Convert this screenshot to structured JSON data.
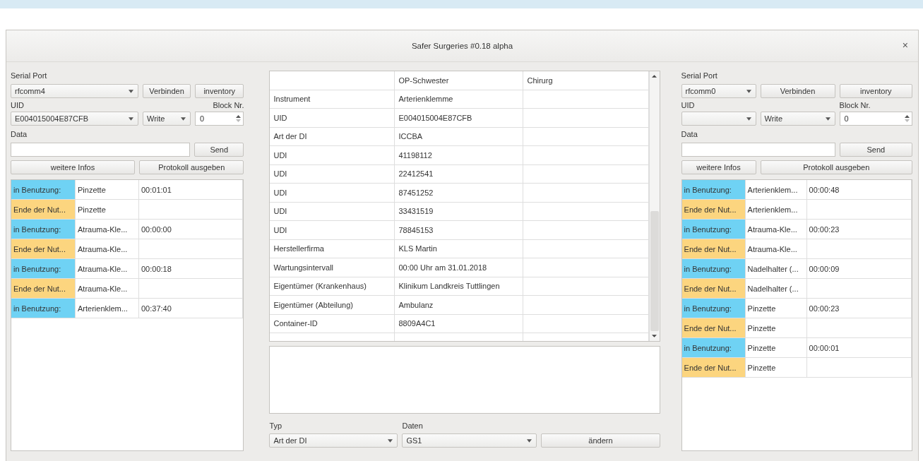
{
  "window": {
    "title": "Safer Surgeries #0.18 alpha",
    "close": "×"
  },
  "panels": [
    {
      "serial_port_label": "Serial Port",
      "port": "rfcomm4",
      "connect_button": "Verbinden",
      "inventory_button": "inventory",
      "uid_label": "UID",
      "block_label": "Block Nr.",
      "uid": "E004015004E87CFB",
      "mode": "Write",
      "block": "0",
      "data_label": "Data",
      "send_button": "Send",
      "info_button": "weitere Infos",
      "log_button": "Protokoll ausgeben",
      "log": [
        {
          "kind": "in_use",
          "status": "in Benutzung:",
          "instrument": "Pinzette",
          "time": "00:01:01"
        },
        {
          "kind": "end",
          "status": "Ende der Nut...",
          "instrument": "Pinzette"
        },
        {
          "kind": "in_use",
          "status": "in Benutzung:",
          "instrument": "Atrauma-Kle...",
          "time": "00:00:00"
        },
        {
          "kind": "end",
          "status": "Ende der Nut...",
          "instrument": "Atrauma-Kle..."
        },
        {
          "kind": "in_use",
          "status": "in Benutzung:",
          "instrument": "Atrauma-Kle...",
          "time": "00:00:18"
        },
        {
          "kind": "end",
          "status": "Ende der Nut...",
          "instrument": "Atrauma-Kle..."
        },
        {
          "kind": "in_use",
          "status": "in Benutzung:",
          "instrument": "Arterienklem...",
          "time": "00:37:40"
        }
      ]
    },
    {
      "serial_port_label": "Serial Port",
      "port": "rfcomm0",
      "connect_button": "Verbinden",
      "inventory_button": "inventory",
      "uid_label": "UID",
      "block_label": "Block Nr.",
      "mode": "Write",
      "block": "0",
      "data_label": "Data",
      "send_button": "Send",
      "info_button": "weitere Infos",
      "log_button": "Protokoll ausgeben",
      "log": [
        {
          "kind": "in_use",
          "status": "in Benutzung:",
          "instrument": "Arterienklem...",
          "time": "00:00:48"
        },
        {
          "kind": "end",
          "status": "Ende der Nut...",
          "instrument": "Arterienklem..."
        },
        {
          "kind": "in_use",
          "status": "in Benutzung:",
          "instrument": "Atrauma-Kle...",
          "time": "00:00:23"
        },
        {
          "kind": "end",
          "status": "Ende der Nut...",
          "instrument": "Atrauma-Kle..."
        },
        {
          "kind": "in_use",
          "status": "in Benutzung:",
          "instrument": "Nadelhalter (...",
          "time": "00:00:09"
        },
        {
          "kind": "end",
          "status": "Ende der Nut...",
          "instrument": "Nadelhalter (..."
        },
        {
          "kind": "in_use",
          "status": "in Benutzung:",
          "instrument": "Pinzette",
          "time": "00:00:23"
        },
        {
          "kind": "end",
          "status": "Ende der Nut...",
          "instrument": "Pinzette"
        },
        {
          "kind": "in_use",
          "status": "in Benutzung:",
          "instrument": "Pinzette",
          "time": "00:00:01"
        },
        {
          "kind": "end",
          "status": "Ende der Nut...",
          "instrument": "Pinzette"
        }
      ]
    }
  ],
  "details": {
    "columns": [
      "OP-Schwester",
      "Chirurg"
    ],
    "rows": [
      {
        "label": "Instrument",
        "value": "Arterienklemme"
      },
      {
        "label": "UID",
        "value": "E004015004E87CFB"
      },
      {
        "label": "Art der DI",
        "value": "ICCBA"
      },
      {
        "label": "UDI",
        "value": "41198112"
      },
      {
        "label": "UDI",
        "value": "22412541"
      },
      {
        "label": "UDI",
        "value": "87451252"
      },
      {
        "label": "UDI",
        "value": "33431519"
      },
      {
        "label": "UDI",
        "value": "78845153"
      },
      {
        "label": "Herstellerfirma",
        "value": "KLS Martin"
      },
      {
        "label": "Wartungsintervall",
        "value": "00:00 Uhr am 31.01.2018"
      },
      {
        "label": "Eigentümer (Krankenhaus)",
        "value": "Klinikum Landkreis Tuttlingen"
      },
      {
        "label": "Eigentümer (Abteilung)",
        "value": "Ambulanz"
      },
      {
        "label": "Container-ID",
        "value": "8809A4C1"
      }
    ]
  },
  "editor": {
    "type_label": "Typ",
    "type": "Art der DI",
    "data_label": "Daten",
    "data": "GS1",
    "change_button": "ändern"
  }
}
